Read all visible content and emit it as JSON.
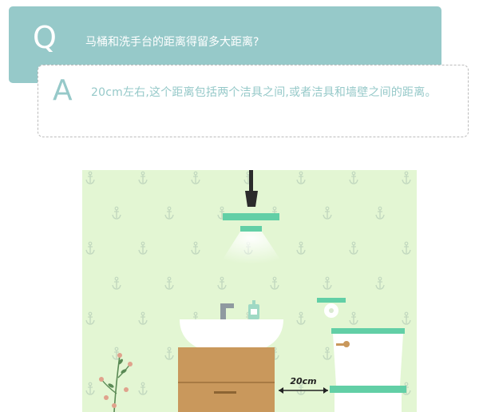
{
  "question": {
    "letter": "Q",
    "text": "马桶和洗手台的距离得留多大距离?"
  },
  "answer": {
    "letter": "A",
    "text": "20cm左右,这个距离包括两个洁具之间,或者洁具和墙壁之间的距离。"
  },
  "illustration": {
    "distance_label": "20cm",
    "icons": [
      "pendant-lamp-icon",
      "sink-icon",
      "faucet-icon",
      "soap-dispenser-icon",
      "cabinet-icon",
      "toilet-icon",
      "toilet-paper-holder-icon",
      "flush-button-icon",
      "plant-icon",
      "anchor-icon"
    ],
    "colors": {
      "wallpaper": "#e3f6d3",
      "anchor": "#c2d8bf",
      "accent": "#62cfa6",
      "cabinet": "#c9985c",
      "fixture": "#ffffff",
      "lamp_stem": "#2b2b2b",
      "flower": "#e0a28c"
    }
  }
}
